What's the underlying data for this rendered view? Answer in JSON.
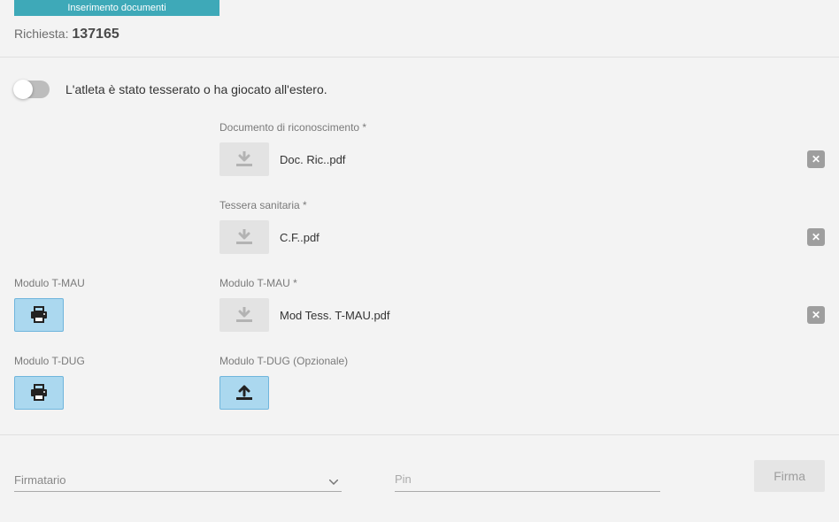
{
  "header": {
    "title": "Inserimento documenti"
  },
  "request": {
    "label": "Richiesta:",
    "number": "137165"
  },
  "toggle": {
    "label": "L'atleta è stato tesserato o ha giocato all'estero.",
    "on": false
  },
  "fields": {
    "doc_riconoscimento": {
      "label": "Documento di riconoscimento *",
      "filename": "Doc. Ric..pdf"
    },
    "tessera_sanitaria": {
      "label": "Tessera sanitaria *",
      "filename": "C.F..pdf"
    },
    "tmau_left": {
      "label": "Modulo T-MAU"
    },
    "tmau_right": {
      "label": "Modulo T-MAU *",
      "filename": "Mod Tess. T-MAU.pdf"
    },
    "tdug_left": {
      "label": "Modulo T-DUG"
    },
    "tdug_right": {
      "label": "Modulo T-DUG (Opzionale)"
    }
  },
  "signature": {
    "firmatario_label": "Firmatario",
    "pin_placeholder": "Pin",
    "firma_label": "Firma"
  }
}
